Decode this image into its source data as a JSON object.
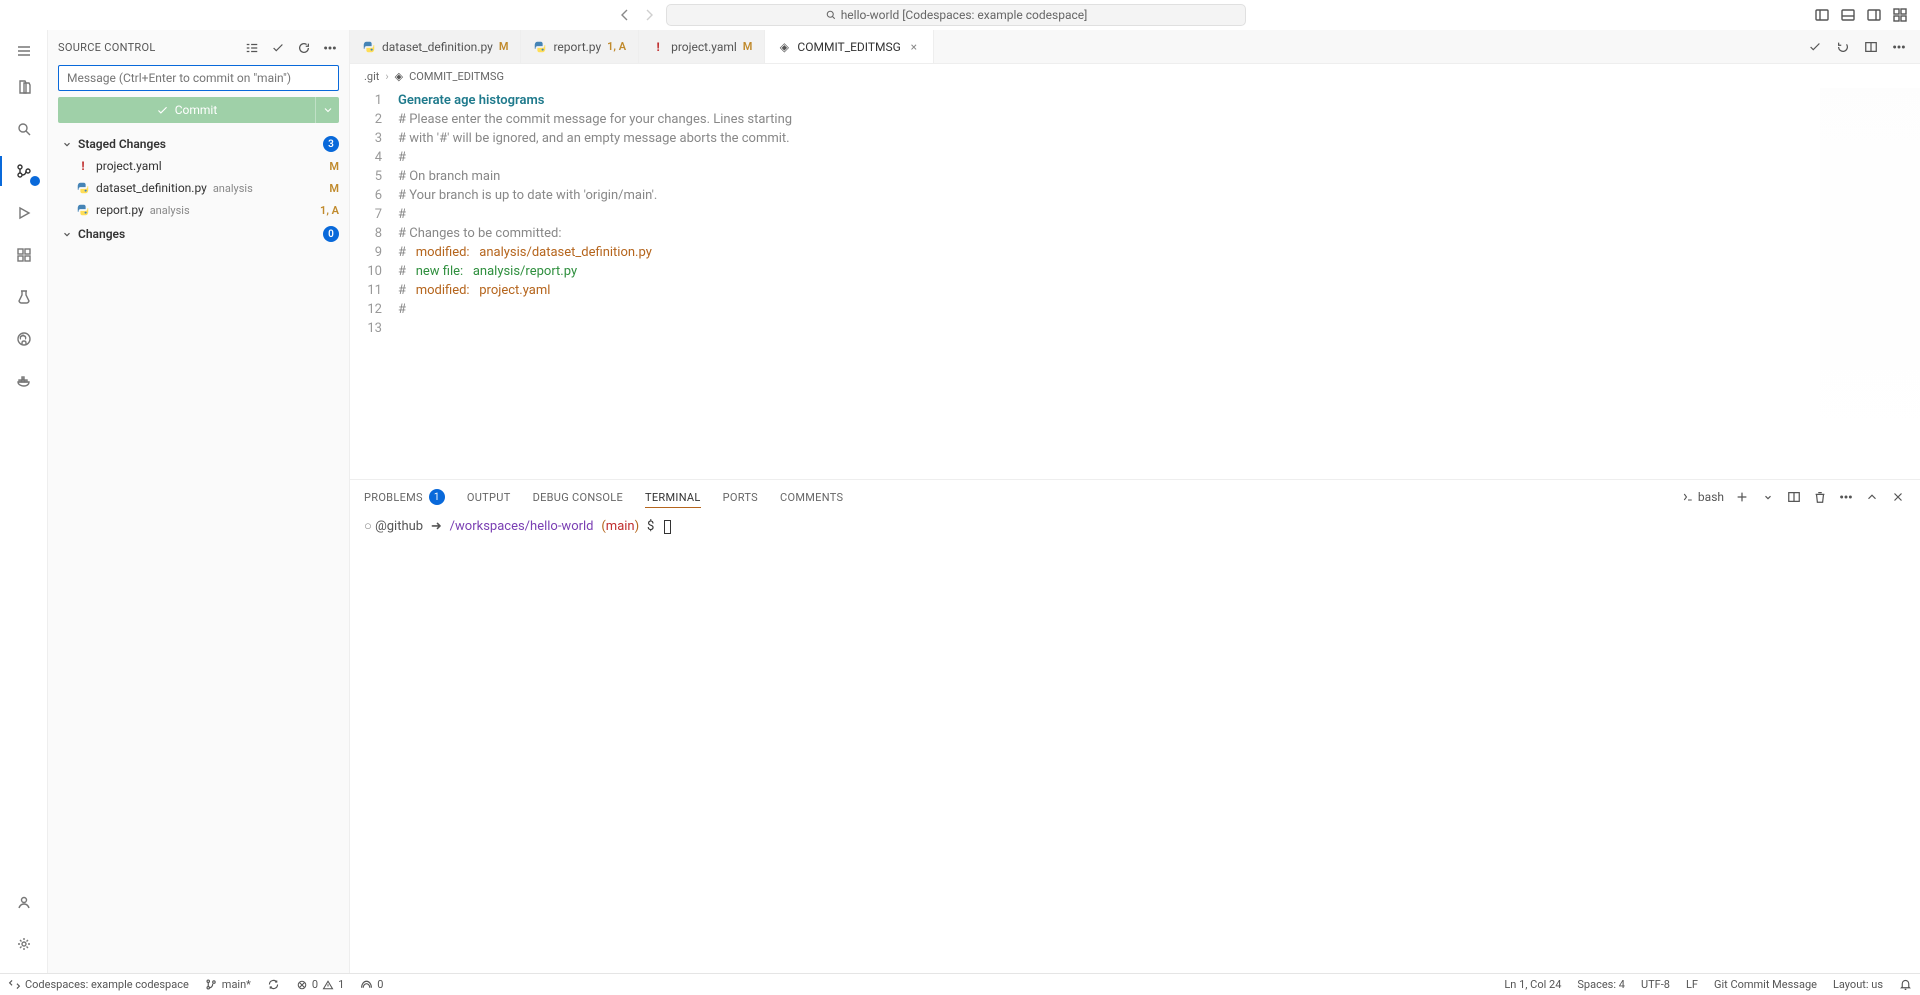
{
  "titlebar": {
    "command_center": "hello-world [Codespaces: example codespace]"
  },
  "sidebar": {
    "title": "SOURCE CONTROL",
    "message_placeholder": "Message (Ctrl+Enter to commit on \"main\")",
    "commit_label": "Commit",
    "sections": {
      "staged": {
        "label": "Staged Changes",
        "count": "3"
      },
      "changes": {
        "label": "Changes",
        "count": "0"
      }
    },
    "files": [
      {
        "name": "project.yaml",
        "dir": "",
        "status": "M",
        "kind": "yaml"
      },
      {
        "name": "dataset_definition.py",
        "dir": "analysis",
        "status": "M",
        "kind": "py"
      },
      {
        "name": "report.py",
        "dir": "analysis",
        "status": "1, A",
        "kind": "py"
      }
    ]
  },
  "tabs": [
    {
      "name": "dataset_definition.py",
      "status": "M",
      "kind": "py"
    },
    {
      "name": "report.py",
      "status": "1, A",
      "kind": "py"
    },
    {
      "name": "project.yaml",
      "status": "M",
      "kind": "yaml"
    },
    {
      "name": "COMMIT_EDITMSG",
      "status": "",
      "kind": "git",
      "active": true
    }
  ],
  "breadcrumb": {
    "seg1": ".git",
    "seg2": "COMMIT_EDITMSG"
  },
  "editor": {
    "lines": [
      {
        "n": "1",
        "segs": [
          {
            "t": "Generate age histograms",
            "c": "tok-title"
          }
        ]
      },
      {
        "n": "2",
        "segs": [
          {
            "t": "# Please enter the commit message for your changes. Lines starting",
            "c": "tok-comment"
          }
        ]
      },
      {
        "n": "3",
        "segs": [
          {
            "t": "# with '#' will be ignored, and an empty message aborts the commit.",
            "c": "tok-comment"
          }
        ]
      },
      {
        "n": "4",
        "segs": [
          {
            "t": "#",
            "c": "tok-comment"
          }
        ]
      },
      {
        "n": "5",
        "segs": [
          {
            "t": "# On branch main",
            "c": "tok-comment"
          }
        ]
      },
      {
        "n": "6",
        "segs": [
          {
            "t": "# Your branch is up to date with 'origin/main'.",
            "c": "tok-comment"
          }
        ]
      },
      {
        "n": "7",
        "segs": [
          {
            "t": "#",
            "c": "tok-comment"
          }
        ]
      },
      {
        "n": "8",
        "segs": [
          {
            "t": "# Changes to be committed:",
            "c": "tok-comment"
          }
        ]
      },
      {
        "n": "9",
        "segs": [
          {
            "t": "#   ",
            "c": "tok-comment"
          },
          {
            "t": "modified:   ",
            "c": "tok-mod"
          },
          {
            "t": "analysis/dataset_definition.py",
            "c": "tok-mod"
          }
        ]
      },
      {
        "n": "10",
        "segs": [
          {
            "t": "#   ",
            "c": "tok-comment"
          },
          {
            "t": "new file:   ",
            "c": "tok-new"
          },
          {
            "t": "analysis/report.py",
            "c": "tok-new"
          }
        ]
      },
      {
        "n": "11",
        "segs": [
          {
            "t": "#   ",
            "c": "tok-comment"
          },
          {
            "t": "modified:   ",
            "c": "tok-mod"
          },
          {
            "t": "project.yaml",
            "c": "tok-mod"
          }
        ]
      },
      {
        "n": "12",
        "segs": [
          {
            "t": "#",
            "c": "tok-comment"
          }
        ]
      },
      {
        "n": "13",
        "segs": [
          {
            "t": "",
            "c": ""
          }
        ]
      }
    ]
  },
  "panel": {
    "tabs": {
      "problems": "PROBLEMS",
      "output": "OUTPUT",
      "debug": "DEBUG CONSOLE",
      "terminal": "TERMINAL",
      "ports": "PORTS",
      "comments": "COMMENTS"
    },
    "problems_count": "1",
    "shell": "bash"
  },
  "terminal": {
    "user": "@github",
    "arrow": "➜",
    "path": "/workspaces/hello-world",
    "branch": "main",
    "prompt": "$"
  },
  "statusbar": {
    "remote": "Codespaces: example codespace",
    "branch": "main*",
    "errors": "0",
    "warnings": "1",
    "ports": "0",
    "cursor": "Ln 1, Col 24",
    "spaces": "Spaces: 4",
    "encoding": "UTF-8",
    "eol": "LF",
    "lang": "Git Commit Message",
    "layout": "Layout: us"
  }
}
